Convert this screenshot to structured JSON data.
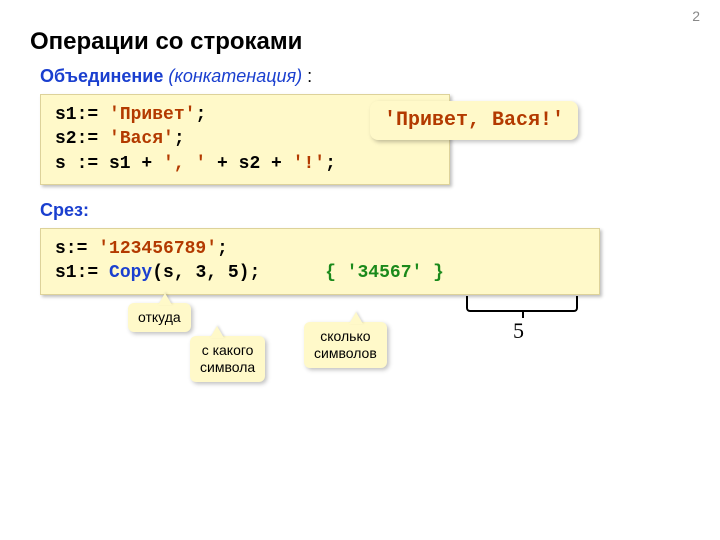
{
  "page_number": "2",
  "title": "Операции со строками",
  "concat": {
    "label": "Объединение",
    "italic": "(конкатенация)",
    "colon": " :",
    "line1": "s1:= 'Привет';",
    "line2": "s2:= 'Вася';",
    "line3_a": "s := s1 + ",
    "line3_b": "', '",
    "line3_c": " + s2 + ",
    "line3_d": "'!'",
    "line3_e": ";",
    "result": "'Привет, Вася!'"
  },
  "slice": {
    "label": "Срез:",
    "line1_a": "s:= ",
    "line1_b": "'123456789'",
    "line1_c": ";",
    "line2_a": "s1:= ",
    "line2_b": "Copy",
    "line2_c": "(s, 3, 5);",
    "line2_gap": "      ",
    "line2_comment": "{ '34567' }",
    "tag_from": "откуда",
    "tag_start": "с какого\nсимвола",
    "tag_count": "сколько\nсимволов",
    "bracket_value": "5"
  }
}
